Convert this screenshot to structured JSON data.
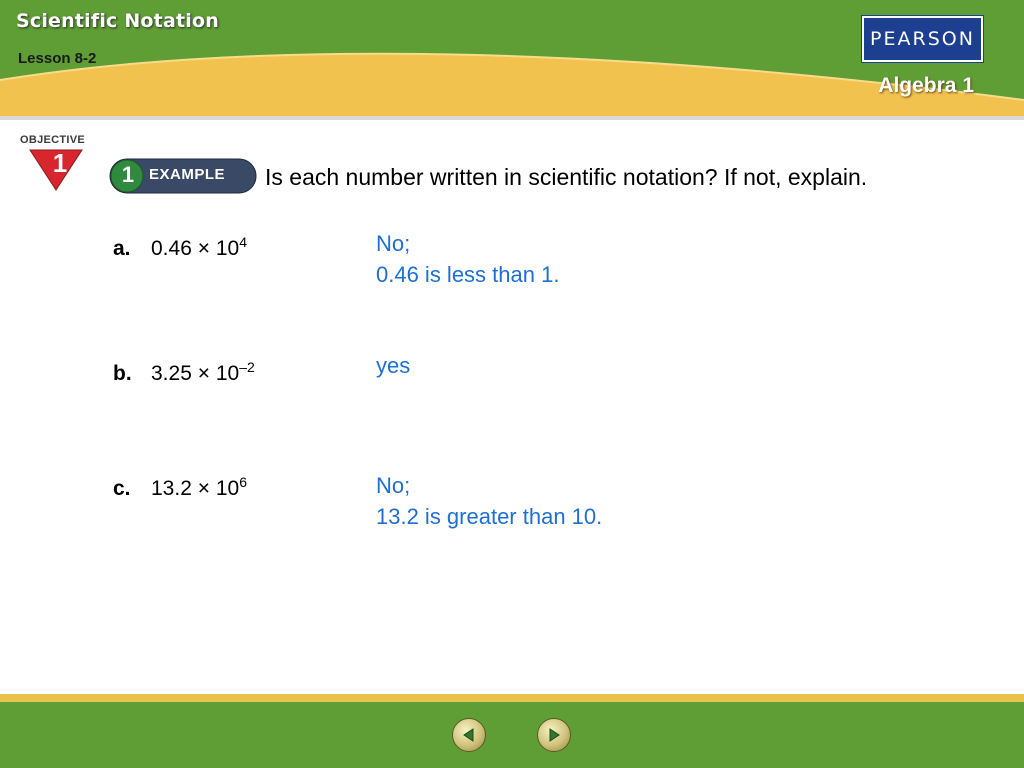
{
  "header": {
    "title": "Scientific Notation",
    "lesson": "Lesson 8-2",
    "logo": "PEARSON",
    "course": "Algebra 1"
  },
  "objective": {
    "label": "OBJECTIVE",
    "number": "1"
  },
  "example": {
    "number": "1",
    "label": "EXAMPLE",
    "question": "Is each number written in scientific notation? If not, explain."
  },
  "problems": [
    {
      "letter": "a.",
      "mantissa": "0.46",
      "times": "×",
      "base": "10",
      "exponent": "4",
      "answer_line1": "No;",
      "answer_line2": "0.46 is less than 1."
    },
    {
      "letter": "b.",
      "mantissa": "3.25",
      "times": "×",
      "base": "10",
      "exponent": "–2",
      "answer_line1": "yes",
      "answer_line2": ""
    },
    {
      "letter": "c.",
      "mantissa": "13.2",
      "times": "×",
      "base": "10",
      "exponent": "6",
      "answer_line1": "No;",
      "answer_line2": "13.2 is greater than 10."
    }
  ],
  "navigation": {
    "prev_icon": "left-arrow-icon",
    "next_icon": "right-arrow-icon"
  },
  "colors": {
    "header_green": "#5e9e35",
    "header_yellow": "#f2c24e",
    "answer_blue": "#1e6fd4",
    "objective_red": "#d8262e",
    "logo_blue": "#1d3f8f"
  }
}
